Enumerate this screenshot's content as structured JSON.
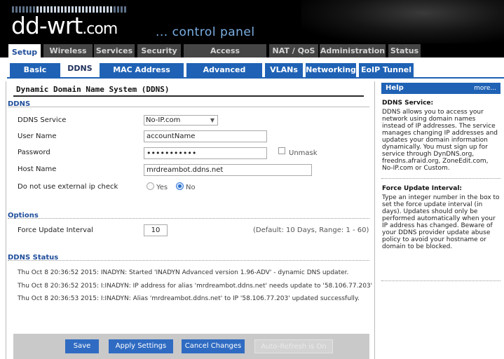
{
  "header": {
    "logo_main": "dd-wrt",
    "logo_suffix": ".com",
    "subtitle": "... control panel"
  },
  "main_tabs": [
    {
      "label": "Setup",
      "active": true
    },
    {
      "label": "Wireless"
    },
    {
      "label": "Services"
    },
    {
      "label": "Security"
    },
    {
      "label": "Access Restrictions"
    },
    {
      "label": "NAT / QoS"
    },
    {
      "label": "Administration"
    },
    {
      "label": "Status"
    }
  ],
  "sub_tabs": [
    {
      "label": "Basic Setup"
    },
    {
      "label": "DDNS",
      "active": true
    },
    {
      "label": "MAC Address Clone"
    },
    {
      "label": "Advanced Routing"
    },
    {
      "label": "VLANs"
    },
    {
      "label": "Networking"
    },
    {
      "label": "EoIP Tunnel"
    }
  ],
  "page_title": "Dynamic Domain Name System (DDNS)",
  "ddns": {
    "legend": "DDNS",
    "service_label": "DDNS Service",
    "service_value": "No-IP.com",
    "username_label": "User Name",
    "username_value": "accountName",
    "password_label": "Password",
    "password_value": "•••••••••••",
    "unmask_label": "Unmask",
    "hostname_label": "Host Name",
    "hostname_value": "mrdreambot.ddns.net",
    "extip_label": "Do not use external ip check",
    "yes_label": "Yes",
    "no_label": "No"
  },
  "options": {
    "legend": "Options",
    "force_label": "Force Update Interval",
    "force_value": "10",
    "force_hint": "(Default: 10 Days, Range: 1 - 60)"
  },
  "status": {
    "legend": "DDNS Status",
    "lines": [
      "Thu Oct 8 20:36:52 2015: INADYN: Started 'INADYN Advanced version 1.96-ADV' - dynamic DNS updater.",
      "Thu Oct 8 20:36:52 2015: I:INADYN: IP address for alias 'mrdreambot.ddns.net' needs update to '58.106.77.203'",
      "Thu Oct 8 20:36:53 2015: I:INADYN: Alias 'mrdreambot.ddns.net' to IP '58.106.77.203' updated successfully."
    ]
  },
  "footer": {
    "save": "Save",
    "apply": "Apply Settings",
    "cancel": "Cancel Changes",
    "autorefresh": "Auto-Refresh is On"
  },
  "help": {
    "title": "Help",
    "more": "more...",
    "sections": [
      {
        "heading": "DDNS Service:",
        "body": "DDNS allows you to access your network using domain names instead of IP addresses. The service manages changing IP addresses and updates your domain information dynamically. You must sign up for service through DynDNS.org, freedns.afraid.org, ZoneEdit.com, No-IP.com or Custom."
      },
      {
        "heading": "Force Update Interval:",
        "body": "Type an integer number in the box to set the force update interval (in days). Updates should only be performed automatically when your IP address has changed. Beware of your DDNS provider update abuse policy to avoid your hostname or domain to be blocked."
      }
    ]
  },
  "colors": {
    "accent_blue": "#1f62b5",
    "legend_blue": "#1f4e9b",
    "header_bg": "#000000",
    "tab_bg": "#454545"
  }
}
